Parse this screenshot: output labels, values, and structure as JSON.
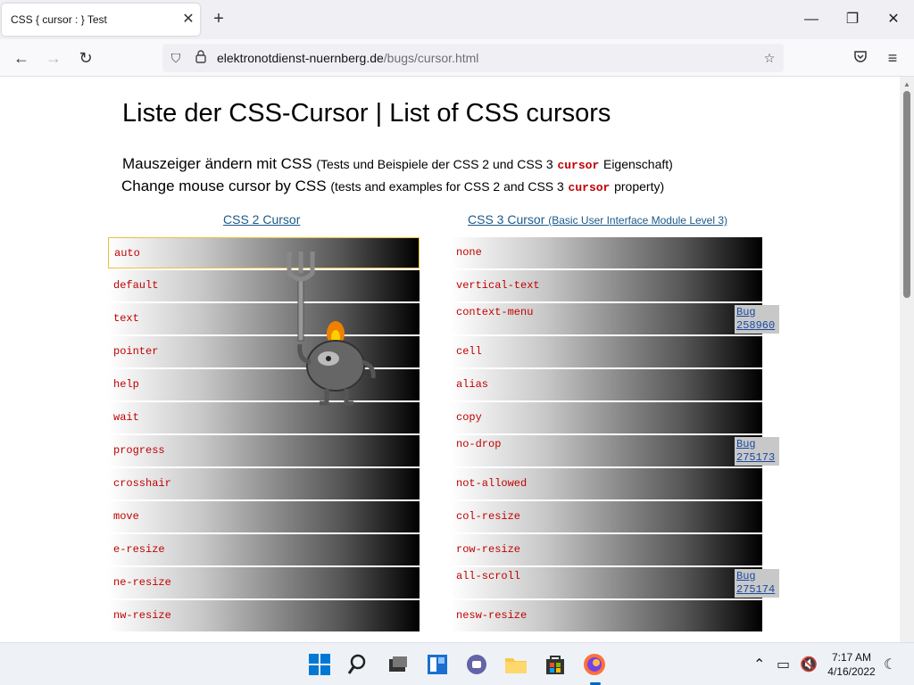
{
  "browser": {
    "tab_title": "CSS { cursor : } Test",
    "tab_close": "✕",
    "new_tab": "+",
    "url_domain": "elektronotdienst-nuernberg.de",
    "url_path": "/bugs/cursor.html"
  },
  "page": {
    "title": "Liste der CSS-Cursor | List of CSS cursors",
    "sub_de_main": "Mauszeiger ändern mit CSS",
    "sub_de_pre": "(Tests und Beispiele der CSS 2 und CSS 3",
    "sub_de_code": "cursor",
    "sub_de_post": "Eigenschaft)",
    "sub_en_main": "Change mouse cursor by CSS",
    "sub_en_pre": "(tests and examples for CSS 2 and CSS 3",
    "sub_en_code": "cursor",
    "sub_en_post": "property)",
    "css2_heading": "CSS 2 Cursor",
    "css3_heading": "CSS 3 Cursor",
    "css3_heading_small": "(Basic User Interface Module Level 3)",
    "css2_rows": [
      "auto",
      "default",
      "text",
      "pointer",
      "help",
      "wait",
      "progress",
      "crosshair",
      "move",
      "e-resize",
      "ne-resize",
      "nw-resize"
    ],
    "css3_rows": [
      {
        "label": "none",
        "bug": ""
      },
      {
        "label": "vertical-text",
        "bug": ""
      },
      {
        "label": "context-menu",
        "bug": "Bug 258960"
      },
      {
        "label": "cell",
        "bug": ""
      },
      {
        "label": "alias",
        "bug": ""
      },
      {
        "label": "copy",
        "bug": ""
      },
      {
        "label": "no-drop",
        "bug": "Bug 275173"
      },
      {
        "label": "not-allowed",
        "bug": ""
      },
      {
        "label": "col-resize",
        "bug": ""
      },
      {
        "label": "row-resize",
        "bug": ""
      },
      {
        "label": "all-scroll",
        "bug": "Bug 275174"
      },
      {
        "label": "nesw-resize",
        "bug": ""
      }
    ]
  },
  "taskbar": {
    "time": "7:17 AM",
    "date": "4/16/2022"
  },
  "colors": {
    "code_red": "#c00000",
    "link_blue": "#1a5a8a",
    "taskbar_bg": "#eef2f7"
  }
}
